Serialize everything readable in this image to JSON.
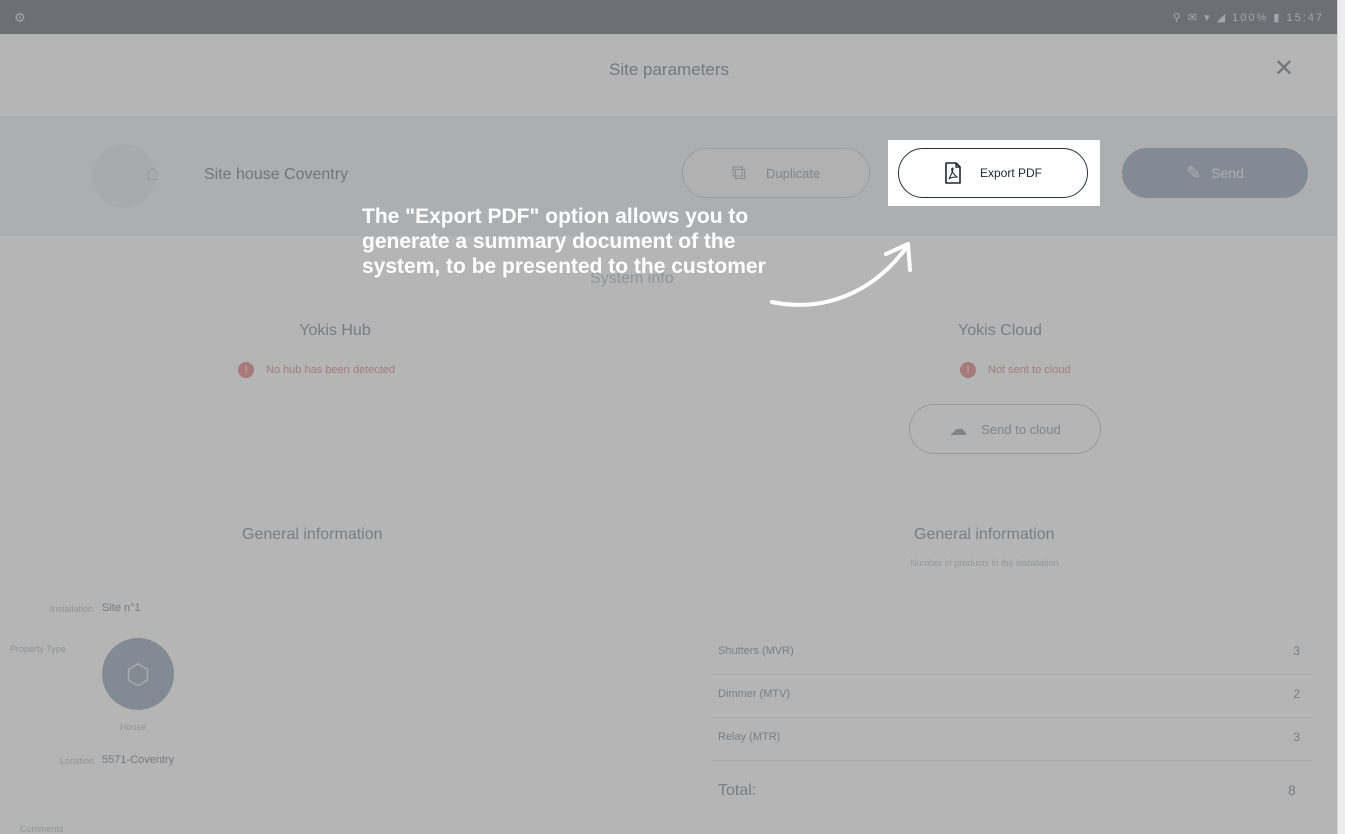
{
  "screen": {
    "title": "Site parameters",
    "close_icon": "close-icon",
    "status_bar_left_icon": "settings-icon",
    "status_bar_right_text": "⚲ ✉ ▾ ◢ 100% ▮ 15:47"
  },
  "site": {
    "name": "Site house Coventry",
    "icon": "home-icon"
  },
  "buttons": {
    "duplicate": "Duplicate",
    "export_pdf": "Export PDF",
    "send": "Send",
    "send_to_cloud": "Send to cloud"
  },
  "section_heading": "System info",
  "hub": {
    "title": "Yokis Hub",
    "error": "No hub has been detected"
  },
  "cloud": {
    "title": "Yokis Cloud",
    "error": "Not sent to cloud"
  },
  "general_info": {
    "left_title": "General information",
    "right_title": "General information",
    "right_subtitle": "Number of products in the installation",
    "left_fields": [
      {
        "label": "Installation",
        "value": "Site n°1"
      },
      {
        "label": "Property Type",
        "value": "House"
      },
      {
        "label": "Location",
        "value": "5571-Coventry"
      }
    ],
    "bottom_label": "Comments"
  },
  "counts": {
    "rows": [
      {
        "label": "Shutters (MVR)",
        "value": "3"
      },
      {
        "label": "Dimmer (MTV)",
        "value": "2"
      },
      {
        "label": "Relay (MTR)",
        "value": "3"
      }
    ],
    "total_label": "Total:",
    "total_value": "8"
  },
  "callout": {
    "text": "The \"Export PDF\" option allows you to generate a summary document of the system, to be presented to the customer"
  },
  "colors": {
    "overlay": "#787878",
    "send_button": "#8ea3b7",
    "export_border": "#253240",
    "error_red": "#e07a7a"
  }
}
